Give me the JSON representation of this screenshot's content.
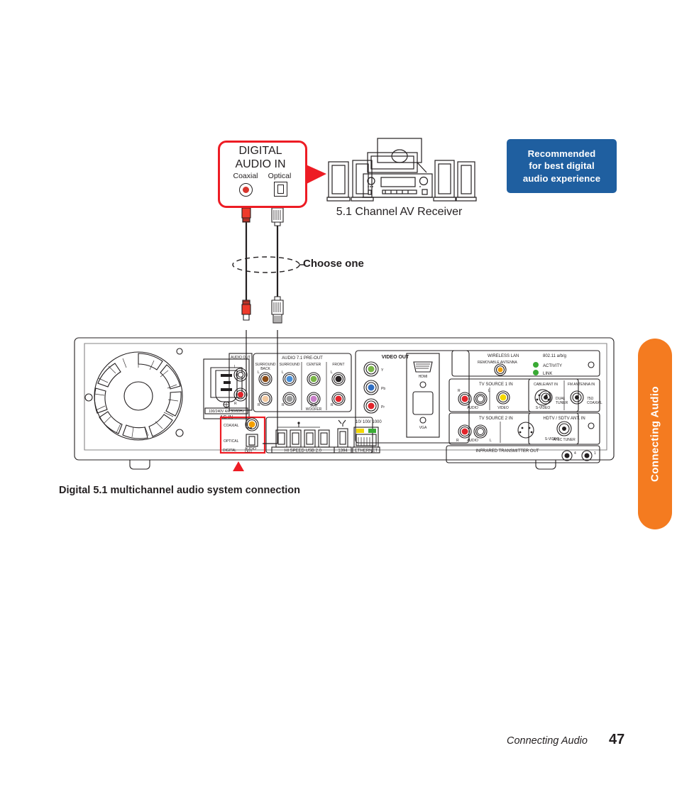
{
  "document": {
    "figure_caption": "Digital 5.1 multichannel audio system connection",
    "side_tab_label": "Connecting Audio",
    "footer_chapter": "Connecting Audio",
    "footer_page_number": "47"
  },
  "badge": {
    "line1": "Recommended",
    "line2": "for best digital",
    "line3": "audio experience",
    "background_color": "#1f5fa0",
    "text_color": "#ffffff"
  },
  "callout": {
    "title_line1": "DIGITAL",
    "title_line2": "AUDIO IN",
    "coaxial_label": "Coaxial",
    "optical_label": "Optical",
    "border_color": "#ed1c24"
  },
  "receiver": {
    "label": "5.1 Channel AV Receiver"
  },
  "cables": {
    "choose_one_label": "Choose one",
    "coaxial_cable_color": "#ee3a2b",
    "optical_cable_color": "#ffffff"
  },
  "rear_panel": {
    "ac_in": {
      "rating": "100/240V 4/A 50/60Hz",
      "label": "AC IN"
    },
    "audio_out": {
      "title": "AUDIO OUT",
      "jacks": [
        {
          "label": "L",
          "color": "#ffffff"
        },
        {
          "label": "R",
          "color": "#e3242b"
        }
      ]
    },
    "audio_pre_out": {
      "title": "AUDIO 7.1 PRE-OUT",
      "columns": [
        {
          "label": "SURROUND BACK",
          "top_color": "#8a4b16",
          "bottom_color": "#f3c9a0"
        },
        {
          "label": "SURROUND",
          "top_color": "#4a90d9",
          "bottom_color": "#9a9a9a"
        },
        {
          "label": "CENTER",
          "top_color": "#7ab648",
          "bottom_color": "#c97fc9"
        },
        {
          "label": "FRONT",
          "top_color": "#231f20",
          "bottom_color": "#e3242b"
        }
      ],
      "sub_woofer_label": "SUB WOOFER"
    },
    "digital_audio_out": {
      "coaxial_label": "COAXIAL",
      "optical_label": "OPTICAL",
      "group_label": "DIGITAL",
      "group_sublabel": "AUDIO OUT",
      "highlight_color": "#ed1c24",
      "coaxial_jack_color": "#f5a000"
    },
    "usb": {
      "label": "HI SPEED USB 2.0",
      "port_count": 4
    },
    "ieee1394": {
      "label": "1394"
    },
    "ethernet": {
      "label": "ETHERNET",
      "speed": "10/ 100/ 1000"
    },
    "video_out": {
      "title": "VIDEO OUT",
      "component": [
        {
          "label": "Y",
          "color": "#7ab648"
        },
        {
          "label": "Pb",
          "color": "#2f6fc4"
        },
        {
          "label": "Pr",
          "color": "#e3242b"
        }
      ],
      "hdmi_label": "HDMI",
      "vga_label": "VGA"
    },
    "wireless_lan": {
      "title": "WIRELESS LAN",
      "standard": "802.11 a/b/g",
      "antenna_label": "REMOVABLE ANTENNA",
      "leds": [
        {
          "label": "ACTIVITY",
          "color": "#3aaa35"
        },
        {
          "label": "LINK",
          "color": "#3aaa35"
        }
      ]
    },
    "tv_source_1": {
      "title": "TV SOURCE  1  IN",
      "audio_label": "AUDIO",
      "audio_left": "L",
      "audio_right": "R",
      "video_label": "VIDEO",
      "svideo_label": "S-VIDEO"
    },
    "tv_source_2": {
      "title": "TV SOURCE  2  IN",
      "audio_label": "AUDIO",
      "audio_left": "L",
      "audio_right": "R",
      "svideo_label": "S-VIDEO"
    },
    "cable_ant_in": {
      "title": "CABLE/ANT IN",
      "sublabel": "DUAL TUNER"
    },
    "fm_antenna_in": {
      "title": "FM ANTENNA IN",
      "sublabel": "75Ω COAXIAL"
    },
    "hdtv_ant_in": {
      "title": "HDTV / SDTV ANT. IN",
      "sublabel": "ATSC TUNER"
    },
    "infrared": {
      "title": "INFRARED TRANSMITTER OUT"
    }
  }
}
